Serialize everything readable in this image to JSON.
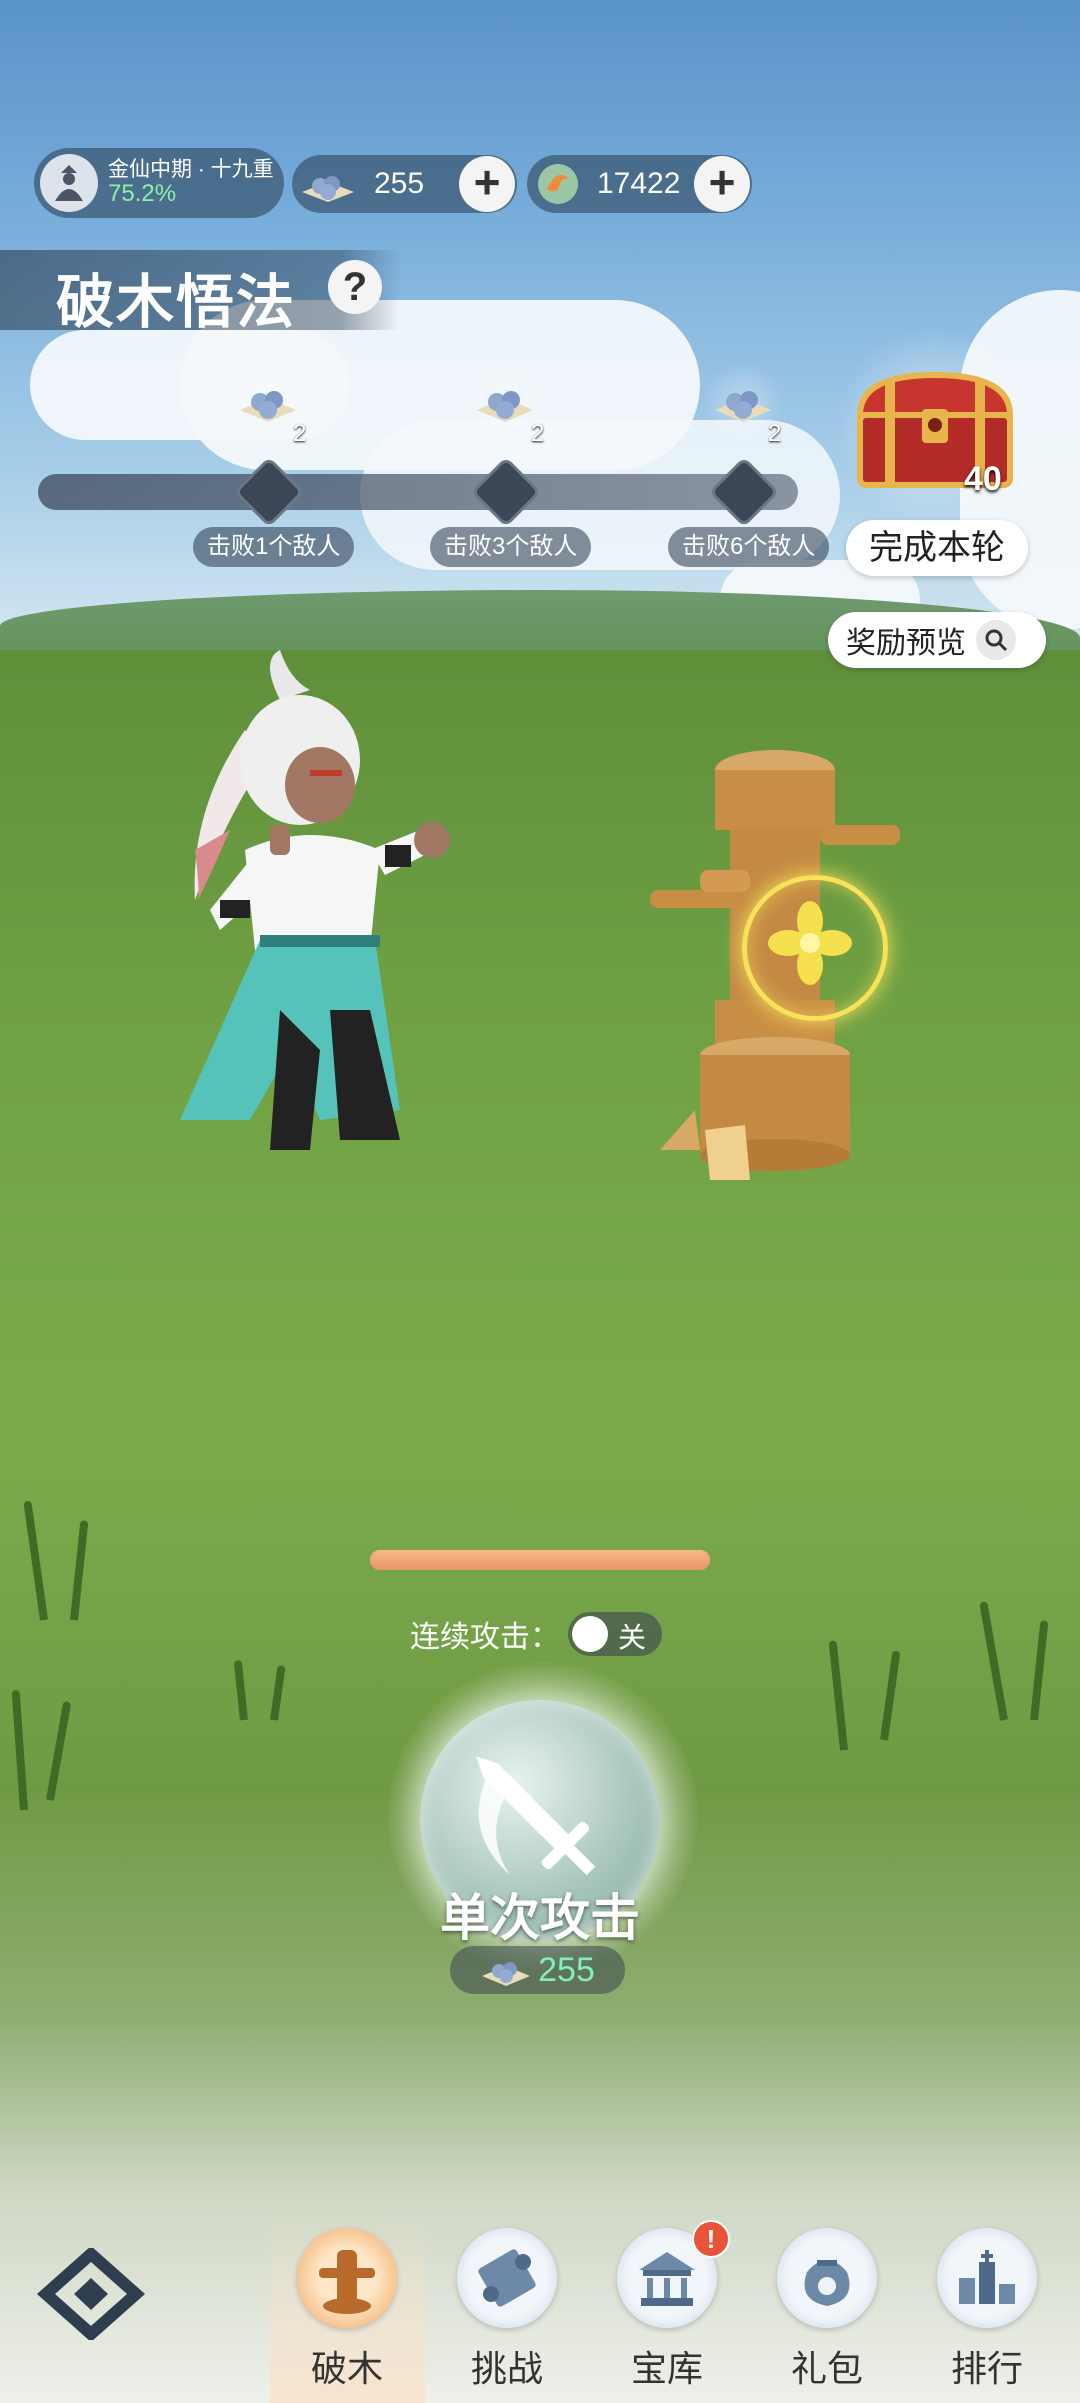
{
  "header": {
    "realm": {
      "name": "金仙中期 · 十九重",
      "progress": "75.2%"
    },
    "currency_a": {
      "value": "255",
      "icon": "spirit-stone-icon"
    },
    "currency_b": {
      "value": "17422",
      "icon": "spirit-coin-icon"
    },
    "add_symbol": "+"
  },
  "page": {
    "title": "破木悟法",
    "help_symbol": "?"
  },
  "milestones": [
    {
      "reward_count": "2",
      "label": "击败1个敌人"
    },
    {
      "reward_count": "2",
      "label": "击败3个敌人"
    },
    {
      "reward_count": "2",
      "label": "击败6个敌人"
    }
  ],
  "chest": {
    "count": "40",
    "complete_label": "完成本轮",
    "icon": "treasure-chest-icon"
  },
  "reward_preview": {
    "label": "奖励预览",
    "icon": "search-icon"
  },
  "target": {
    "hp_fraction": 1.0
  },
  "auto_attack": {
    "label": "连续攻击：",
    "state": "关"
  },
  "attack": {
    "label": "单次攻击",
    "cost": "255",
    "icon": "sword-icon"
  },
  "nav": [
    {
      "label": "破木",
      "icon": "wooden-dummy-icon",
      "active": true
    },
    {
      "label": "挑战",
      "icon": "scroll-icon",
      "active": false
    },
    {
      "label": "宝库",
      "icon": "treasury-icon",
      "active": false,
      "badge": "!"
    },
    {
      "label": "礼包",
      "icon": "gift-bag-icon",
      "active": false
    },
    {
      "label": "排行",
      "icon": "ranking-icon",
      "active": false
    }
  ],
  "colors": {
    "accent_orange": "#f2a35a",
    "hp_bar": "#e89567",
    "cost_green": "#7ff0b8"
  }
}
